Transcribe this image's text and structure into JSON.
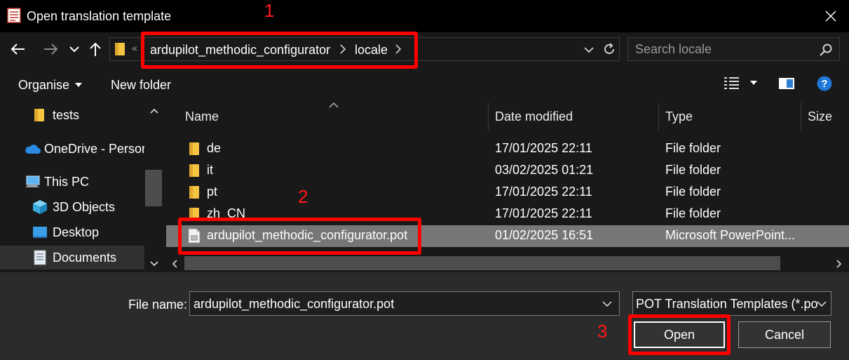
{
  "window": {
    "title": "Open translation template"
  },
  "address": {
    "breadcrumb": [
      "ardupilot_methodic_configurator",
      "locale"
    ],
    "search_placeholder": "Search locale"
  },
  "toolbar": {
    "organise_label": "Organise",
    "new_folder_label": "New folder"
  },
  "nav": {
    "items": [
      {
        "label": "tests",
        "icon": "folder-icon"
      },
      {
        "label": "OneDrive - Person",
        "icon": "onedrive-cloud-icon"
      },
      {
        "label": "This PC",
        "icon": "computer-icon"
      },
      {
        "label": "3D Objects",
        "icon": "3d-objects-icon"
      },
      {
        "label": "Desktop",
        "icon": "desktop-icon"
      },
      {
        "label": "Documents",
        "icon": "documents-icon"
      }
    ]
  },
  "files": {
    "columns": [
      "Name",
      "Date modified",
      "Type",
      "Size"
    ],
    "rows": [
      {
        "name": "de",
        "date": "17/01/2025 22:11",
        "type": "File folder",
        "icon": "folder-icon"
      },
      {
        "name": "it",
        "date": "03/02/2025 01:21",
        "type": "File folder",
        "icon": "folder-icon"
      },
      {
        "name": "pt",
        "date": "17/01/2025 22:11",
        "type": "File folder",
        "icon": "folder-icon"
      },
      {
        "name": "zh_CN",
        "date": "17/01/2025 22:11",
        "type": "File folder",
        "icon": "folder-icon"
      },
      {
        "name": "ardupilot_methodic_configurator.pot",
        "date": "01/02/2025 16:51",
        "type": "Microsoft PowerPoint...",
        "icon": "document-icon",
        "selected": true
      }
    ]
  },
  "bottom": {
    "filename_label": "File name:",
    "filename_value": "ardupilot_methodic_configurator.pot",
    "filetype_value": "POT Translation Templates (*.po",
    "open_label": "Open",
    "cancel_label": "Cancel"
  },
  "annotations": {
    "step1": "1",
    "step2": "2",
    "step3": "3",
    "color": "#ff0000"
  },
  "colors": {
    "background": "#191919",
    "titlebar": "#000000",
    "selected_row": "#777777",
    "help_blue": "#1e78d6"
  }
}
